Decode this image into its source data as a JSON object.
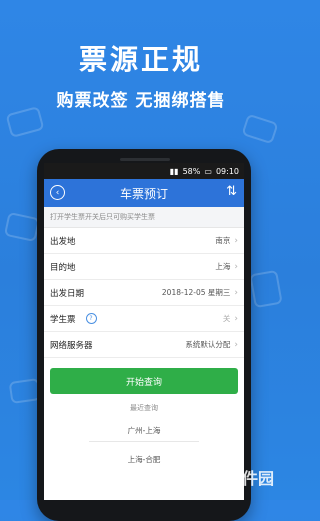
{
  "promo": {
    "headline": "票源正规",
    "subheadline": "购票改签  无捆绑搭售"
  },
  "status_bar": {
    "battery": "58%",
    "time": "09:10"
  },
  "app_bar": {
    "title": "车票预订",
    "back_icon": "back-circle-icon",
    "swap_icon": "swap-arrows-icon"
  },
  "form": {
    "hint": "打开学生票开关后只可购买学生票",
    "rows": [
      {
        "label": "出发地",
        "value": "南京"
      },
      {
        "label": "目的地",
        "value": "上海"
      },
      {
        "label": "出发日期",
        "value": "2018-12-05 星期三"
      },
      {
        "label": "学生票",
        "value": "关"
      },
      {
        "label": "网络服务器",
        "value": "系统默认分配"
      }
    ],
    "help_icon": "?"
  },
  "actions": {
    "start_query": "开始查询"
  },
  "recent": {
    "title": "最近查询",
    "items": [
      "广州-上海",
      "上海-合肥"
    ]
  },
  "watermark": {
    "text": "当下软件园",
    "logo_glyph": "⏻"
  },
  "colors": {
    "background": "#2f86e6",
    "app_bar": "#2d73d9",
    "start_button": "#2fae48"
  }
}
